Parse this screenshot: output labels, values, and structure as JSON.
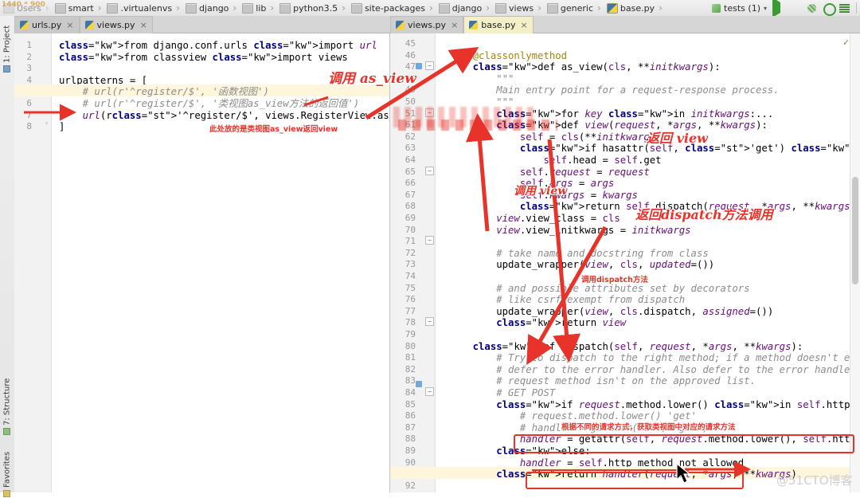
{
  "window": {
    "resolution_badge": "1440 * 900",
    "watermark": "@51CTO博客"
  },
  "breadcrumb": {
    "items": [
      {
        "label": "Users",
        "icon": "folder-icon"
      },
      {
        "label": "smart",
        "icon": "folder-icon"
      },
      {
        "label": ".virtualenvs",
        "icon": "folder-icon"
      },
      {
        "label": "django",
        "icon": "folder-icon"
      },
      {
        "label": "lib",
        "icon": "folder-icon"
      },
      {
        "label": "python3.5",
        "icon": "folder-icon"
      },
      {
        "label": "site-packages",
        "icon": "folder-icon"
      },
      {
        "label": "django",
        "icon": "folder-icon"
      },
      {
        "label": "views",
        "icon": "folder-icon"
      },
      {
        "label": "generic",
        "icon": "folder-icon"
      },
      {
        "label": "base.py",
        "icon": "python-file-icon"
      }
    ]
  },
  "toolbar": {
    "run_config": "tests (1)",
    "buttons": [
      {
        "name": "run-button",
        "icon": "play-icon"
      },
      {
        "name": "debug-button",
        "icon": "bug-icon"
      },
      {
        "name": "run-coverage-button",
        "icon": "bug-shaded-icon"
      },
      {
        "name": "profile-button",
        "icon": "circle-play-icon"
      },
      {
        "name": "attach-button",
        "icon": "list-icon"
      }
    ]
  },
  "left_tabs": [
    {
      "label": "urls.py",
      "active": true,
      "icon": "python-file-icon",
      "close": "×"
    },
    {
      "label": "views.py",
      "active": false,
      "icon": "python-file-icon",
      "close": "×"
    }
  ],
  "right_tabs": [
    {
      "label": "views.py",
      "active": false,
      "icon": "python-file-icon",
      "close": "×"
    },
    {
      "label": "base.py",
      "active": true,
      "icon": "python-file-icon",
      "close": "×"
    }
  ],
  "sidebar": {
    "tools": [
      {
        "label": "1: Project",
        "icon": "project-icon"
      },
      {
        "label": "7: Structure",
        "icon": "structure-icon"
      },
      {
        "label": "Favorites",
        "icon": "favorites-icon"
      }
    ]
  },
  "left_editor": {
    "file": "urls.py",
    "first_line": 1,
    "current_line": 5,
    "lines": [
      {
        "n": 1,
        "text": "from django.conf.urls import url"
      },
      {
        "n": 2,
        "text": "from classview import views"
      },
      {
        "n": 3,
        "text": ""
      },
      {
        "n": 4,
        "text": "urlpatterns = ["
      },
      {
        "n": 5,
        "text": "    # url(r'^register/$', '函数视图')"
      },
      {
        "n": 6,
        "text": "    # url(r'^register/$', '类视图as_view方法的返回值')"
      },
      {
        "n": 7,
        "text": "    url(r'^register/$', views.RegisterView.as_view())"
      },
      {
        "n": 8,
        "text": "]"
      }
    ]
  },
  "right_editor": {
    "file": "base.py",
    "current_line": 91,
    "lines": [
      {
        "n": 45,
        "text": ""
      },
      {
        "n": 46,
        "text": "    @classonlymethod"
      },
      {
        "n": 47,
        "text": "    def as_view(cls, **initkwargs):"
      },
      {
        "n": 48,
        "text": "        \"\"\""
      },
      {
        "n": 49,
        "text": "        Main entry point for a request-response process."
      },
      {
        "n": 50,
        "text": "        \"\"\""
      },
      {
        "n": 51,
        "text": "        for key in initkwargs:..."
      },
      {
        "n": 61,
        "text": "        def view(request, *args, **kwargs):"
      },
      {
        "n": 62,
        "text": "            self = cls(**initkwargs)"
      },
      {
        "n": 63,
        "text": "            if hasattr(self, 'get') and not hasattr(self, 'head'):"
      },
      {
        "n": 64,
        "text": "                self.head = self.get"
      },
      {
        "n": 65,
        "text": "            self.request = request"
      },
      {
        "n": 66,
        "text": "            self.args = args"
      },
      {
        "n": 67,
        "text": "            self.kwargs = kwargs"
      },
      {
        "n": 68,
        "text": "            return self.dispatch(request, *args, **kwargs)"
      },
      {
        "n": 69,
        "text": "        view.view_class = cls"
      },
      {
        "n": 70,
        "text": "        view.view_initkwargs = initkwargs"
      },
      {
        "n": 71,
        "text": ""
      },
      {
        "n": 72,
        "text": "        # take name and docstring from class"
      },
      {
        "n": 73,
        "text": "        update_wrapper(view, cls, updated=())"
      },
      {
        "n": 74,
        "text": ""
      },
      {
        "n": 75,
        "text": "        # and possible attributes set by decorators"
      },
      {
        "n": 76,
        "text": "        # like csrf_exempt from dispatch"
      },
      {
        "n": 77,
        "text": "        update_wrapper(view, cls.dispatch, assigned=())"
      },
      {
        "n": 78,
        "text": "        return view"
      },
      {
        "n": 79,
        "text": ""
      },
      {
        "n": 80,
        "text": "    def dispatch(self, request, *args, **kwargs):"
      },
      {
        "n": 81,
        "text": "        # Try to dispatch to the right method; if a method doesn't e"
      },
      {
        "n": 82,
        "text": "        # defer to the error handler. Also defer to the error handle"
      },
      {
        "n": 83,
        "text": "        # request method isn't on the approved list."
      },
      {
        "n": 84,
        "text": "        # GET POST"
      },
      {
        "n": 85,
        "text": "        if request.method.lower() in self.http_method_names:"
      },
      {
        "n": 86,
        "text": "            # request.method.lower() 'get'"
      },
      {
        "n": 87,
        "text": "            # handler = getattr(self, 'get')"
      },
      {
        "n": 88,
        "text": "            handler = getattr(self, request.method.lower(), self.htt"
      },
      {
        "n": 89,
        "text": "        else:"
      },
      {
        "n": 90,
        "text": "            handler = self.http_method_not_allowed"
      },
      {
        "n": 91,
        "text": "        return handler(request, *args, **kwargs)"
      },
      {
        "n": 92,
        "text": ""
      }
    ]
  },
  "annotations": {
    "color": "#e8332a",
    "notes": [
      {
        "id": "call-as-view",
        "text": "调用 as_view",
        "style": "handwritten"
      },
      {
        "id": "return-view-here",
        "text": "此处放的是类视图as_view返回view",
        "style": "small"
      },
      {
        "id": "return-view",
        "text": "返回 view",
        "style": "handwritten"
      },
      {
        "id": "call-view",
        "text": "调用 view",
        "style": "handwritten"
      },
      {
        "id": "return-dispatch",
        "text": "返回dispatch方法调用",
        "style": "handwritten"
      },
      {
        "id": "call-dispatch",
        "text": "调用dispatch方法",
        "style": "small"
      },
      {
        "id": "get-handler",
        "text": "根据不同的请求方式，获取类视图中对应的请求方法",
        "style": "small"
      }
    ]
  }
}
